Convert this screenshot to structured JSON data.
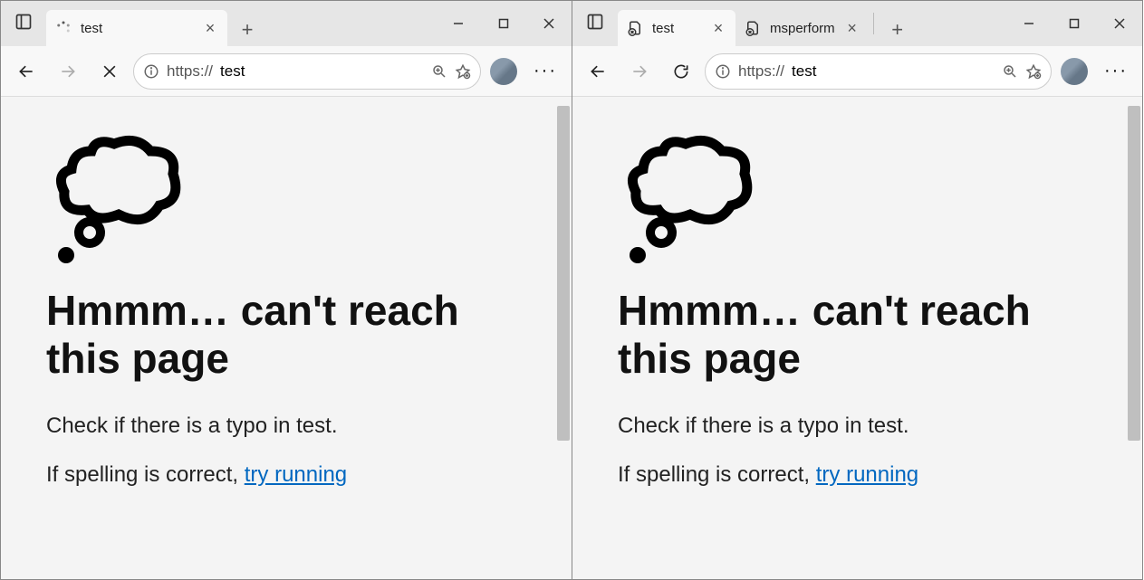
{
  "left": {
    "tab": {
      "title": "test"
    },
    "url_prefix": "https://",
    "url_host": "test",
    "error": {
      "heading": "Hmmm… can't reach this page",
      "line1": "Check if there is a typo in test.",
      "line2_pre": "If spelling is correct, ",
      "line2_link": "try running"
    }
  },
  "right": {
    "tab1": {
      "title": "test"
    },
    "tab2": {
      "title": "msperform"
    },
    "url_prefix": "https://",
    "url_host": "test",
    "error": {
      "heading": "Hmmm… can't reach this page",
      "line1": "Check if there is a typo in test.",
      "line2_pre": "If spelling is correct, ",
      "line2_link": "try running"
    }
  }
}
